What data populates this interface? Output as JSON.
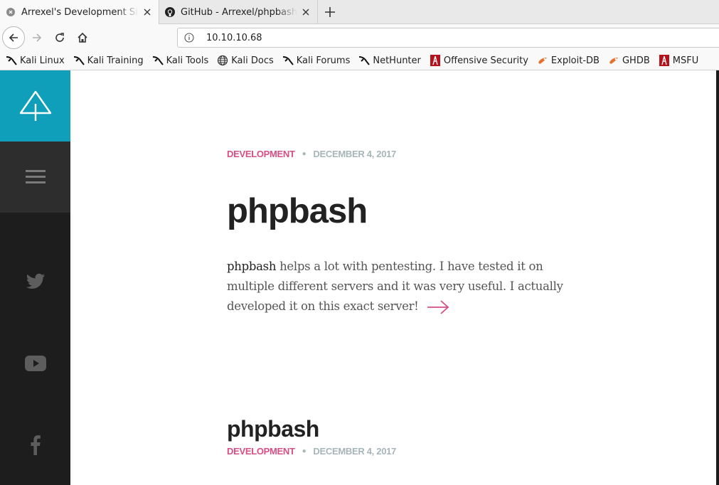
{
  "browser": {
    "tabs": [
      {
        "title": "Arrexel's Development Site",
        "active": true
      },
      {
        "title": "GitHub - Arrexel/phpbash: A",
        "active": false
      }
    ],
    "url": "10.10.10.68",
    "bookmarks": [
      {
        "label": "Kali Linux",
        "icon": "kali-dragon-icon"
      },
      {
        "label": "Kali Training",
        "icon": "kali-dragon-icon"
      },
      {
        "label": "Kali Tools",
        "icon": "kali-dragon-icon"
      },
      {
        "label": "Kali Docs",
        "icon": "globe-icon"
      },
      {
        "label": "Kali Forums",
        "icon": "kali-dragon-icon"
      },
      {
        "label": "NetHunter",
        "icon": "kali-dragon-icon"
      },
      {
        "label": "Offensive Security",
        "icon": "offsec-icon"
      },
      {
        "label": "Exploit-DB",
        "icon": "exploitdb-icon"
      },
      {
        "label": "GHDB",
        "icon": "exploitdb-icon"
      },
      {
        "label": "MSFU",
        "icon": "offsec-icon"
      }
    ]
  },
  "sidebar": {
    "logo_icon": "tree-logo-icon",
    "menu_icon": "hamburger-menu-icon",
    "social": [
      "twitter-icon",
      "youtube-icon",
      "facebook-icon"
    ]
  },
  "posts": [
    {
      "category": "DEVELOPMENT",
      "date": "DECEMBER 4, 2017",
      "title": "phpbash",
      "excerpt_strong": "phpbash",
      "excerpt_rest": " helps a lot with pentesting. I have tested it on multiple different servers and it was very useful. I actually developed it on this exact server!"
    },
    {
      "category": "DEVELOPMENT",
      "date": "DECEMBER 4, 2017",
      "title": "phpbash"
    }
  ],
  "colors": {
    "accent_teal": "#0f9fbb",
    "category_pink": "#d54f86",
    "date_grey": "#a6b6b8",
    "sidebar_dark": "#1d1d1d"
  }
}
